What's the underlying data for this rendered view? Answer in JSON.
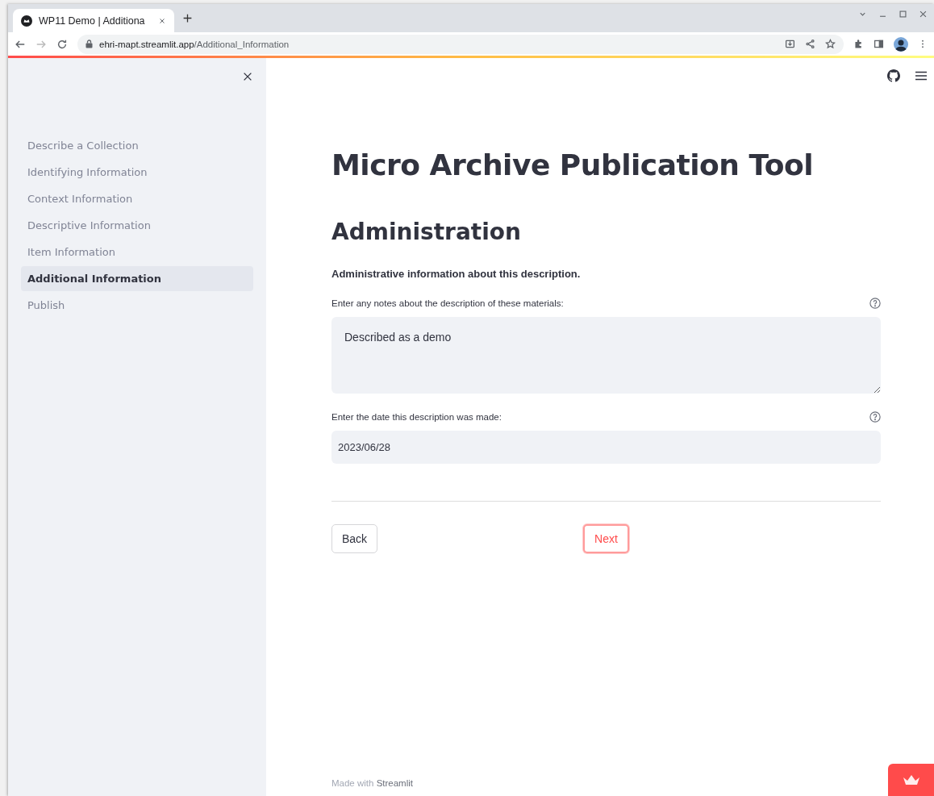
{
  "browser": {
    "tab_title": "WP11 Demo | Additiona",
    "url_host": "ehri-mapt.streamlit.app",
    "url_path": "/Additional_Information"
  },
  "sidebar": {
    "items": [
      {
        "label": "Describe a Collection",
        "selected": false
      },
      {
        "label": "Identifying Information",
        "selected": false
      },
      {
        "label": "Context Information",
        "selected": false
      },
      {
        "label": "Descriptive Information",
        "selected": false
      },
      {
        "label": "Item Information",
        "selected": false
      },
      {
        "label": "Additional Information",
        "selected": true
      },
      {
        "label": "Publish",
        "selected": false
      }
    ]
  },
  "title": "Micro Archive Publication Tool",
  "heading": "Administration",
  "intro": "Administrative information about this description.",
  "fields": [
    {
      "kind": "textarea",
      "label": "Enter any notes about the description of these materials:",
      "value": "Described as a demo"
    },
    {
      "kind": "input",
      "label": "Enter the date this description was made:",
      "value": "2023/06/28"
    }
  ],
  "buttons": [
    {
      "label": "Back",
      "focused": false
    },
    {
      "label": "Next",
      "focused": true
    }
  ],
  "footer": {
    "text": "Made with",
    "link": "Streamlit"
  }
}
